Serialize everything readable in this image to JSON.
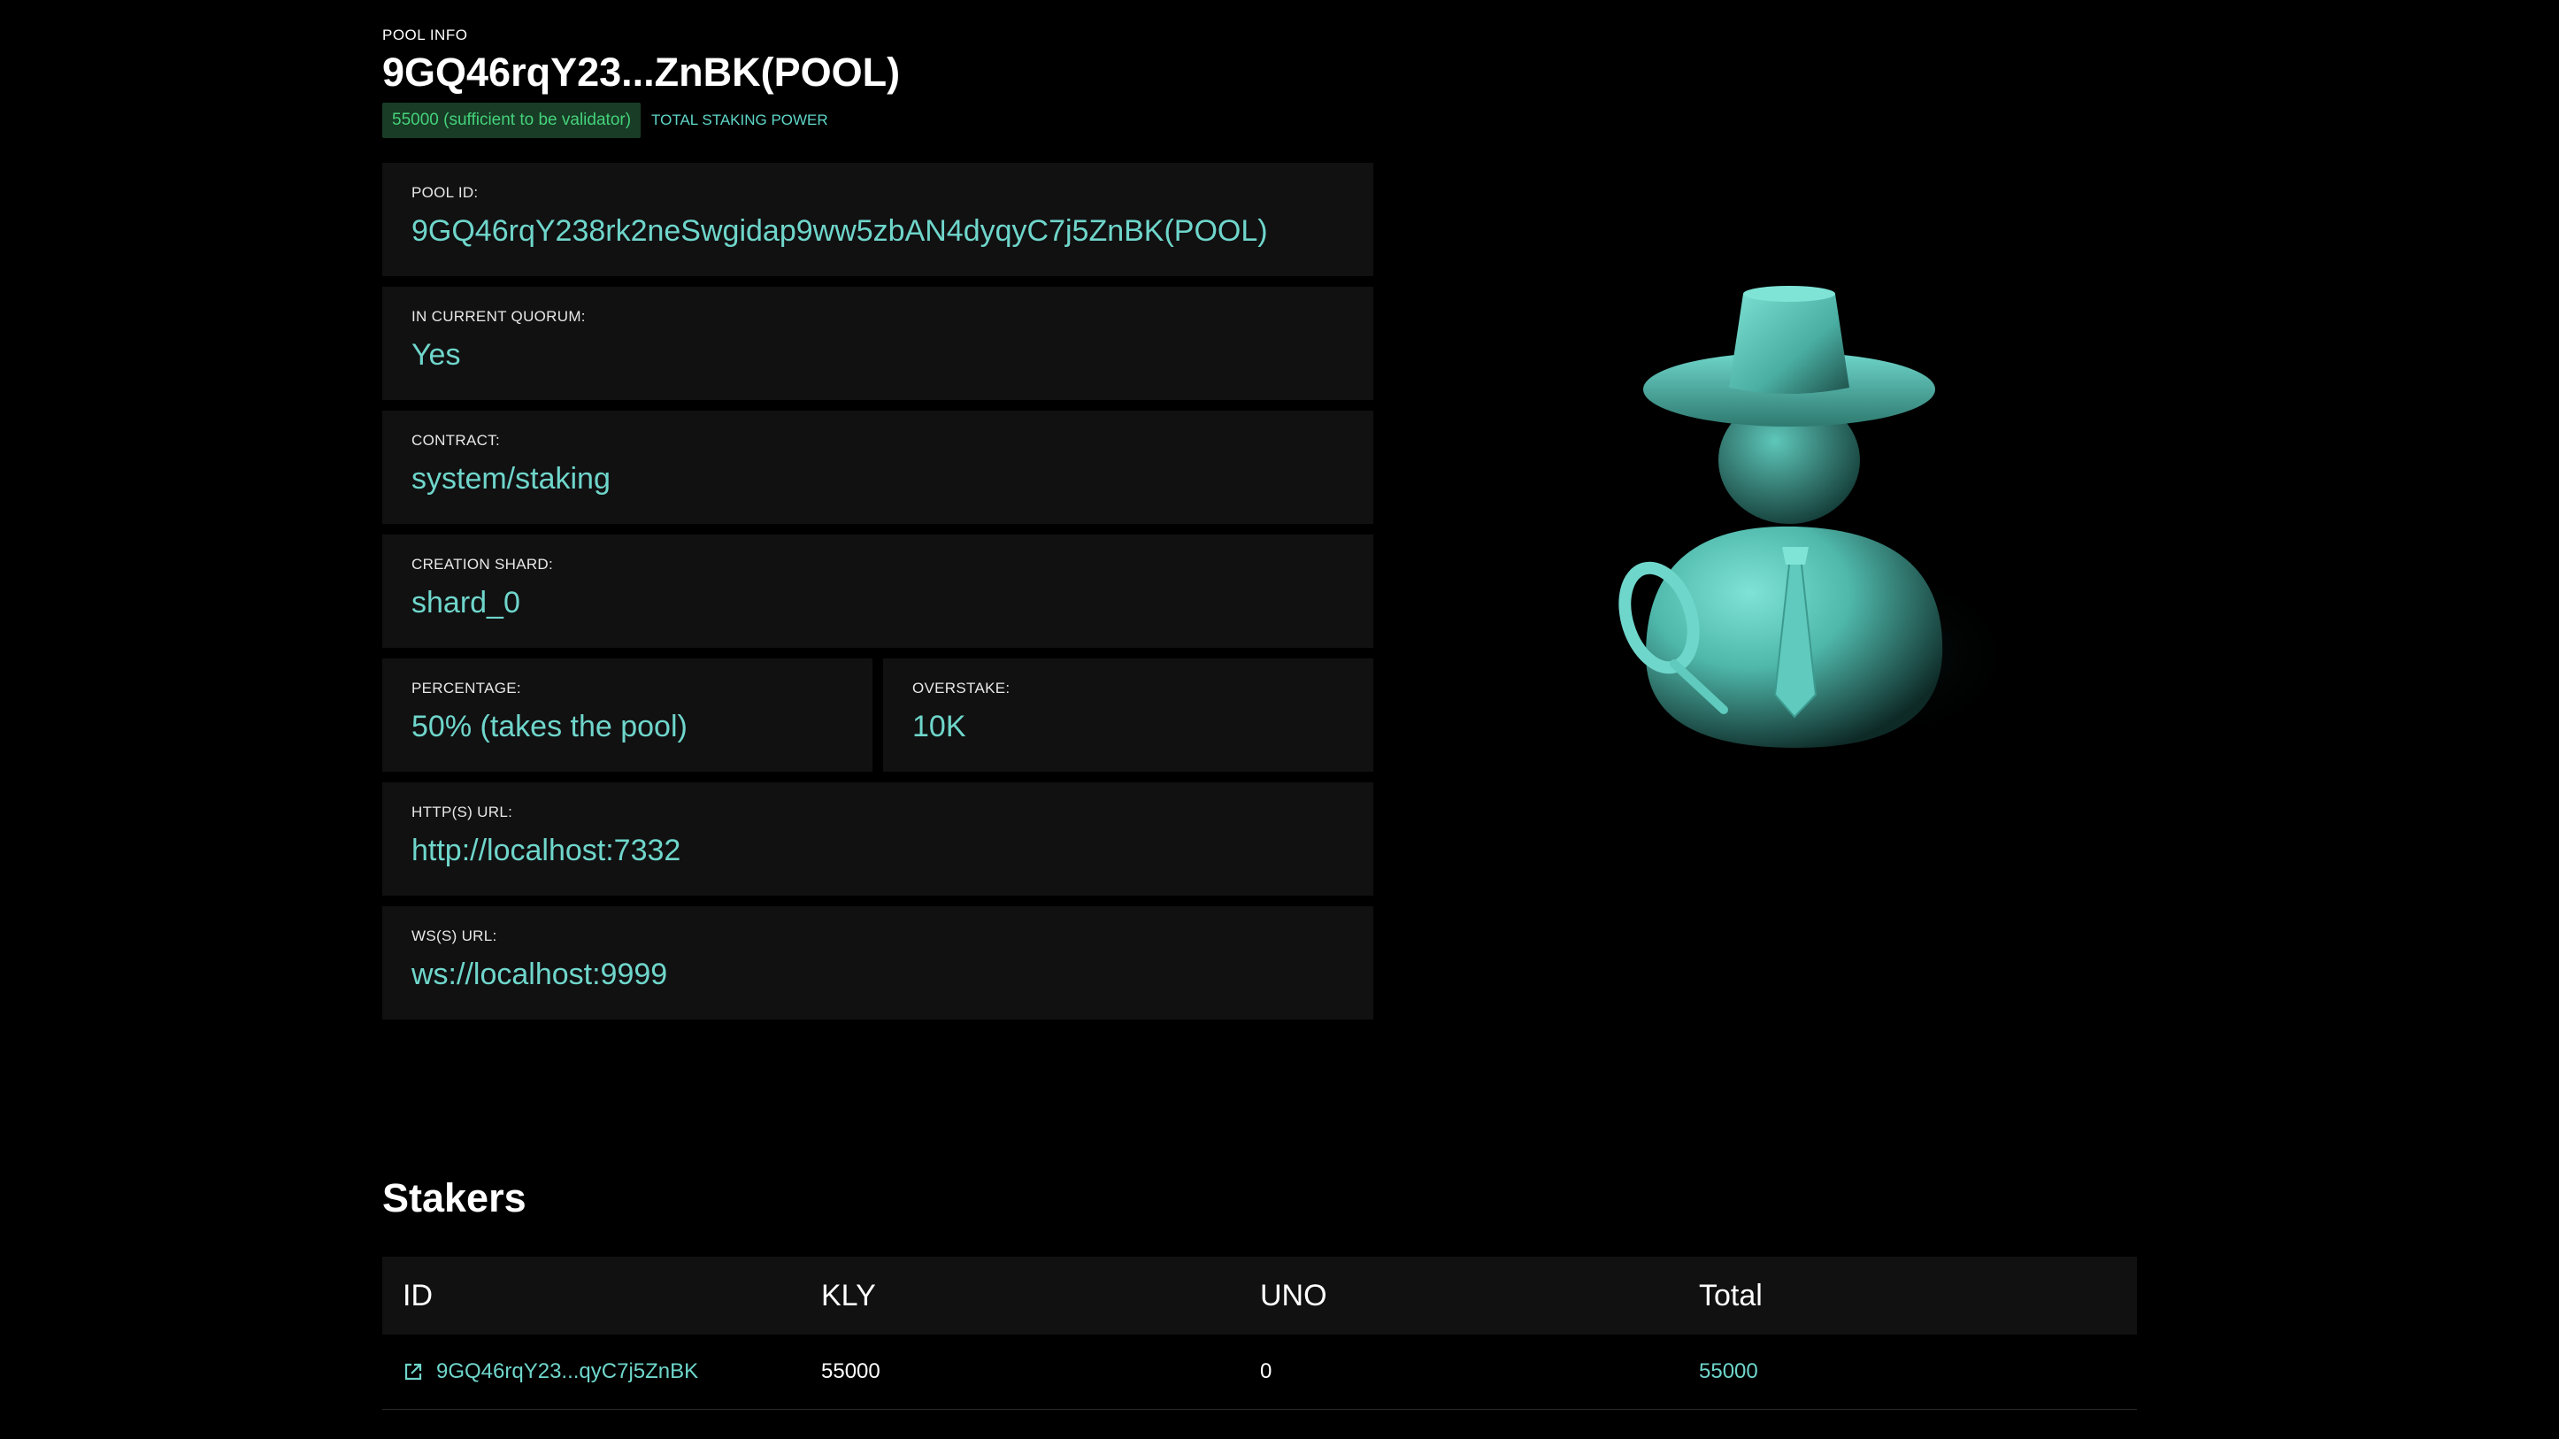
{
  "header": {
    "eyebrow": "POOL INFO",
    "title": "9GQ46rqY23...ZnBK(POOL)",
    "power_badge": "55000 (sufficient to be validator)",
    "power_label": "TOTAL STAKING POWER"
  },
  "fields": {
    "pool_id": {
      "label": "POOL ID:",
      "value": "9GQ46rqY238rk2neSwgidap9ww5zbAN4dyqyC7j5ZnBK(POOL)"
    },
    "quorum": {
      "label": "IN CURRENT QUORUM:",
      "value": "Yes"
    },
    "contract": {
      "label": "CONTRACT:",
      "value": "system/staking"
    },
    "shard": {
      "label": "CREATION SHARD:",
      "value": "shard_0"
    },
    "percentage": {
      "label": "PERCENTAGE:",
      "value": "50% (takes the pool)"
    },
    "overstake": {
      "label": "OVERSTAKE:",
      "value": "10K"
    },
    "http_url": {
      "label": "HTTP(S) URL:",
      "value": "http://localhost:7332"
    },
    "ws_url": {
      "label": "WS(S) URL:",
      "value": "ws://localhost:9999"
    }
  },
  "stakers": {
    "title": "Stakers",
    "columns": [
      "ID",
      "KLY",
      "UNO",
      "Total"
    ],
    "rows": [
      {
        "id": "9GQ46rqY23...qyC7j5ZnBK",
        "kly": "55000",
        "uno": "0",
        "total": "55000"
      }
    ]
  },
  "icons": {
    "external_link": "external-link-icon",
    "avatar": "detective-avatar-illustration"
  },
  "colors": {
    "accent": "#6fd6cb",
    "badge_bg": "#183c26",
    "badge_text": "#45d17a",
    "card_bg": "#111112"
  }
}
